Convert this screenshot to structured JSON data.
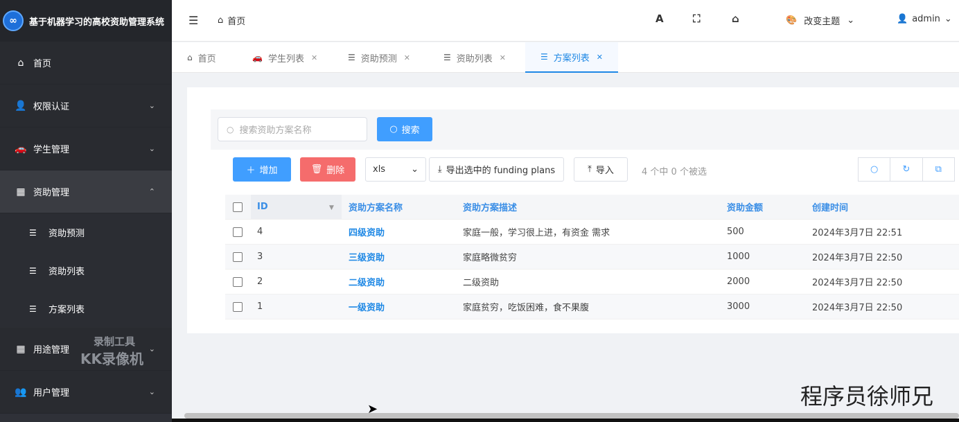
{
  "app": {
    "title": "基于机器学习的高校资助管理系统",
    "logo_glyph": "∞"
  },
  "sidebar": {
    "items": [
      {
        "label": "首页",
        "icon": "home-icon",
        "glyph": "⌂"
      },
      {
        "label": "权限认证",
        "icon": "user-lock-icon",
        "glyph": "👤"
      },
      {
        "label": "学生管理",
        "icon": "car-icon",
        "glyph": "🚗"
      },
      {
        "label": "资助管理",
        "icon": "table-icon",
        "glyph": "▦"
      },
      {
        "label": "用途管理",
        "icon": "table-icon",
        "glyph": "▦"
      },
      {
        "label": "用户管理",
        "icon": "users-icon",
        "glyph": "👥"
      }
    ],
    "subitems": [
      {
        "label": "资助预测"
      },
      {
        "label": "资助列表"
      },
      {
        "label": "方案列表"
      }
    ],
    "list_glyph": "☰",
    "chevron_down": "⌄",
    "chevron_up": "⌃"
  },
  "header": {
    "home_label": "首页",
    "font_icon_glyph": "A",
    "fullscreen_glyph": "⛶",
    "home_glyph": "⌂",
    "theme_label": "改变主题",
    "user_label": "admin"
  },
  "tabs": [
    {
      "label": "首页",
      "icon": "home-icon",
      "closable": false
    },
    {
      "label": "学生列表",
      "icon": "car-icon",
      "closable": true
    },
    {
      "label": "资助预测",
      "icon": "list-icon",
      "closable": true
    },
    {
      "label": "资助列表",
      "icon": "list-icon",
      "closable": true
    },
    {
      "label": "方案列表",
      "icon": "list-icon",
      "closable": true,
      "active": true
    }
  ],
  "search": {
    "placeholder": "搜索资助方案名称",
    "button_label": "搜索"
  },
  "toolbar": {
    "add_label": "增加",
    "delete_label": "删除",
    "format_value": "xls",
    "export_label": "导出选中的 funding plans",
    "import_label": "导入",
    "selection_text": "4 个中 0 个被选"
  },
  "table": {
    "columns": [
      "ID",
      "资助方案名称",
      "资助方案描述",
      "资助金额",
      "创建时间"
    ],
    "rows": [
      {
        "id": "4",
        "name": "四级资助",
        "desc": "家庭一般，学习很上进，有资金 需求",
        "amount": "500",
        "time": "2024年3月7日 22:51"
      },
      {
        "id": "3",
        "name": "三级资助",
        "desc": "家庭略微贫穷",
        "amount": "1000",
        "time": "2024年3月7日 22:50"
      },
      {
        "id": "2",
        "name": "二级资助",
        "desc": "二级资助",
        "amount": "2000",
        "time": "2024年3月7日 22:50"
      },
      {
        "id": "1",
        "name": "一级资助",
        "desc": "家庭贫穷，吃饭困难，食不果腹",
        "amount": "3000",
        "time": "2024年3月7日 22:50"
      }
    ]
  },
  "overlay": {
    "watermark_line1": "录制工具",
    "watermark_line2": "KK录像机",
    "signature": "程序员徐师兄"
  },
  "colors": {
    "accent": "#409eff",
    "danger": "#f56c6c",
    "sidebar_bg": "#2f3138"
  }
}
